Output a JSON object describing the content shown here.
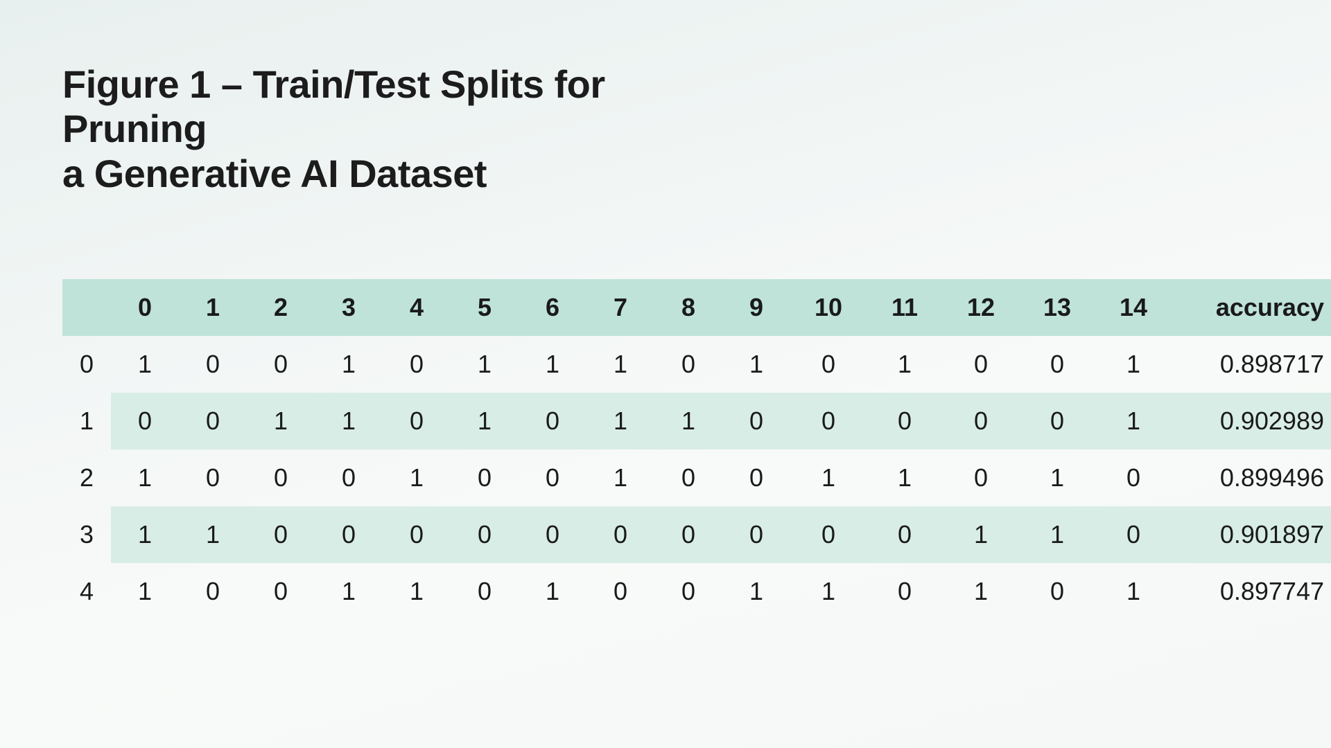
{
  "title_line1": "Figure 1 – Train/Test Splits for Pruning",
  "title_line2": "a Generative AI Dataset",
  "chart_data": {
    "type": "table",
    "columns": [
      "0",
      "1",
      "2",
      "3",
      "4",
      "5",
      "6",
      "7",
      "8",
      "9",
      "10",
      "11",
      "12",
      "13",
      "14",
      "accuracy"
    ],
    "row_index": [
      "0",
      "1",
      "2",
      "3",
      "4"
    ],
    "rows": [
      {
        "c0": "1",
        "c1": "0",
        "c2": "0",
        "c3": "1",
        "c4": "0",
        "c5": "1",
        "c6": "1",
        "c7": "1",
        "c8": "0",
        "c9": "1",
        "c10": "0",
        "c11": "1",
        "c12": "0",
        "c13": "0",
        "c14": "1",
        "accuracy": "0.898717"
      },
      {
        "c0": "0",
        "c1": "0",
        "c2": "1",
        "c3": "1",
        "c4": "0",
        "c5": "1",
        "c6": "0",
        "c7": "1",
        "c8": "1",
        "c9": "0",
        "c10": "0",
        "c11": "0",
        "c12": "0",
        "c13": "0",
        "c14": "1",
        "accuracy": "0.902989"
      },
      {
        "c0": "1",
        "c1": "0",
        "c2": "0",
        "c3": "0",
        "c4": "1",
        "c5": "0",
        "c6": "0",
        "c7": "1",
        "c8": "0",
        "c9": "0",
        "c10": "1",
        "c11": "1",
        "c12": "0",
        "c13": "1",
        "c14": "0",
        "accuracy": "0.899496"
      },
      {
        "c0": "1",
        "c1": "1",
        "c2": "0",
        "c3": "0",
        "c4": "0",
        "c5": "0",
        "c6": "0",
        "c7": "0",
        "c8": "0",
        "c9": "0",
        "c10": "0",
        "c11": "0",
        "c12": "1",
        "c13": "1",
        "c14": "0",
        "accuracy": "0.901897"
      },
      {
        "c0": "1",
        "c1": "0",
        "c2": "0",
        "c3": "1",
        "c4": "1",
        "c5": "0",
        "c6": "1",
        "c7": "0",
        "c8": "0",
        "c9": "1",
        "c10": "1",
        "c11": "0",
        "c12": "1",
        "c13": "0",
        "c14": "1",
        "accuracy": "0.897747"
      }
    ]
  }
}
